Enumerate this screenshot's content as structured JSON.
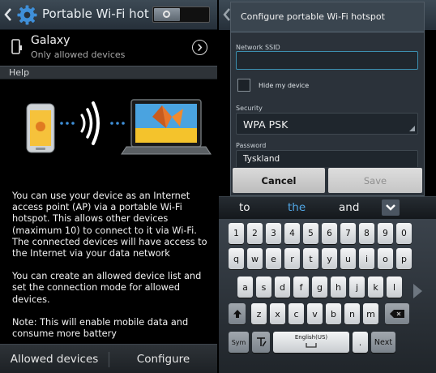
{
  "left": {
    "actionbar": {
      "title": "Portable Wi-Fi hotspot"
    },
    "galaxy": {
      "title": "Galaxy",
      "subtitle": "Only allowed devices"
    },
    "help": {
      "header": "Help"
    },
    "help_text": [
      "You can use your device as an Internet access point (AP) via a portable Wi-Fi hotspot. This allows other devices (maximum 10) to connect to it via Wi-Fi. The connected devices will have access to the Internet via your data network",
      "You can create an allowed device list and set the connection mode for allowed devices.",
      "Note: This will enable mobile data and consume more battery"
    ],
    "bottom_bar": {
      "allowed_devices": "Allowed devices",
      "configure": "Configure"
    }
  },
  "dialog": {
    "title": "Configure portable Wi-Fi hotspot",
    "ssid_label": "Network SSID",
    "ssid_value": "",
    "hide_label": "Hide my device",
    "security_label": "Security",
    "security_value": "WPA PSK",
    "password_label": "Password",
    "password_value": "Tyskland",
    "cancel": "Cancel",
    "save": "Save"
  },
  "suggestions": [
    "to",
    "the",
    "and"
  ],
  "keyboard": {
    "row_numbers": [
      "1",
      "2",
      "3",
      "4",
      "5",
      "6",
      "7",
      "8",
      "9",
      "0"
    ],
    "row_q": [
      "q",
      "w",
      "e",
      "r",
      "t",
      "y",
      "u",
      "i",
      "o",
      "p"
    ],
    "row_a": [
      "a",
      "s",
      "d",
      "f",
      "g",
      "h",
      "j",
      "k",
      "l"
    ],
    "row_z": [
      "z",
      "x",
      "c",
      "v",
      "b",
      "n",
      "m"
    ],
    "sym": "Sym",
    "space": "English(US)",
    "period": ".",
    "next": "Next"
  },
  "colors": {
    "accent": "#52a8e8",
    "input_focus": "#3c8fb0"
  }
}
